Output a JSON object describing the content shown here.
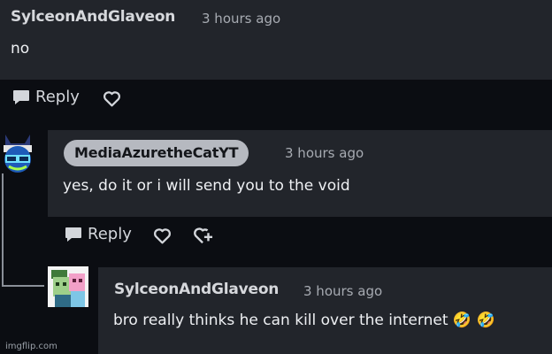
{
  "comments": [
    {
      "username": "SylceonAndGlaveon",
      "timestamp": "3 hours ago",
      "text": "no",
      "actions": {
        "reply_label": "Reply"
      }
    },
    {
      "username": "MediaAzuretheCatYT",
      "timestamp": "3 hours ago",
      "text": "yes, do it or i will send you to the void",
      "actions": {
        "reply_label": "Reply"
      }
    },
    {
      "username": "SylceonAndGlaveon",
      "timestamp": "3 hours ago",
      "text": "bro really thinks he can kill over the internet 🤣 🤣"
    }
  ],
  "icons": {
    "reply": "speech-bubble-icon",
    "like": "heart-icon",
    "give": "heart-plus-icon"
  },
  "colors": {
    "background": "#0b0d12",
    "panel": "#22252b",
    "username_pill": "#b6b9c0",
    "text": "#eef0f3",
    "muted": "#a7abb2"
  },
  "watermark": "imgflip.com"
}
